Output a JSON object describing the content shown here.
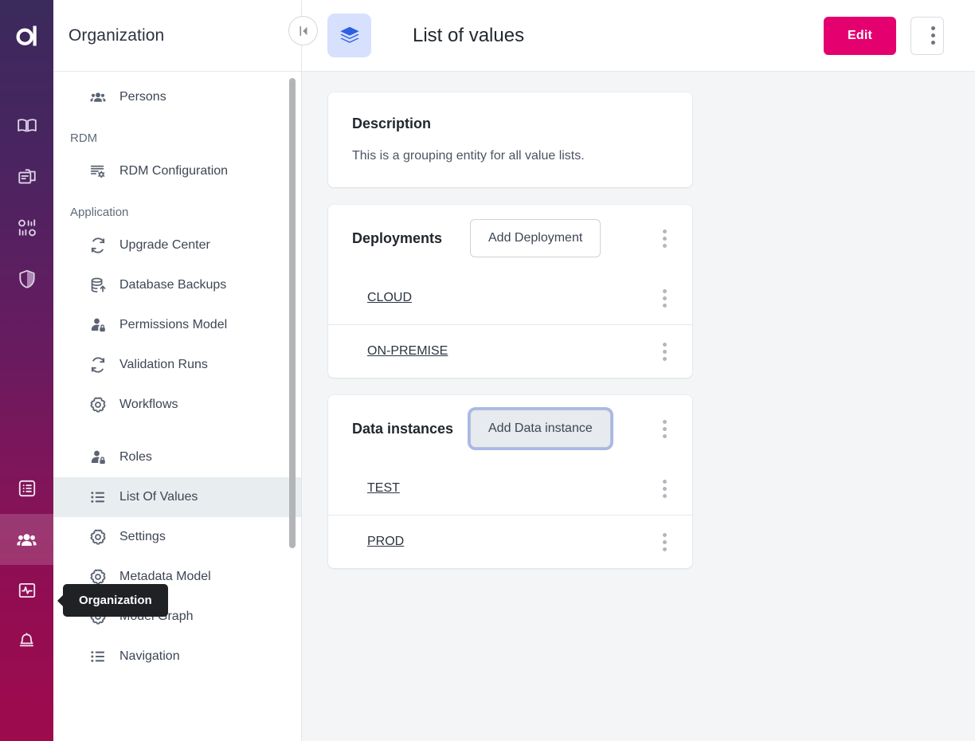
{
  "brand": {
    "logo_letter": "a",
    "rail_gradient_top": "#3B2A5C",
    "rail_gradient_bottom": "#9E0B4D",
    "accent_pink": "#E4006E",
    "entity_icon_bg": "#D7E0FD",
    "entity_icon_color": "#2F5FE0",
    "selected_nav_bg": "#E8EDF0"
  },
  "rail": {
    "logo_name": "logo-a-icon",
    "items": [
      {
        "name": "book-icon",
        "active": false
      },
      {
        "name": "folders-icon",
        "active": false
      },
      {
        "name": "data-model-icon",
        "active": false
      },
      {
        "name": "shield-icon",
        "active": false
      },
      {
        "name": "list-box-icon",
        "active": false
      },
      {
        "name": "people-icon",
        "active": true
      },
      {
        "name": "monitoring-icon",
        "active": false
      },
      {
        "name": "bell-icon",
        "active": false
      }
    ]
  },
  "sidebar": {
    "title": "Organization",
    "scrollbar": {
      "name": "sidebar-scrollbar"
    },
    "items": [
      {
        "type": "item",
        "label": "Persons",
        "icon": "people-icon",
        "selected": false
      },
      {
        "type": "group",
        "label": "RDM"
      },
      {
        "type": "item",
        "label": "RDM Configuration",
        "icon": "list-settings-icon",
        "selected": false
      },
      {
        "type": "group",
        "label": "Application"
      },
      {
        "type": "item",
        "label": "Upgrade Center",
        "icon": "refresh-icon",
        "selected": false
      },
      {
        "type": "item",
        "label": "Database Backups",
        "icon": "database-up-icon",
        "selected": false
      },
      {
        "type": "item",
        "label": "Permissions Model",
        "icon": "user-lock-icon",
        "selected": false
      },
      {
        "type": "item",
        "label": "Validation Runs",
        "icon": "refresh-icon",
        "selected": false
      },
      {
        "type": "item",
        "label": "Workflows",
        "icon": "gear-icon",
        "selected": false
      },
      {
        "type": "blank"
      },
      {
        "type": "item",
        "label": "Roles",
        "icon": "user-lock-icon",
        "selected": false
      },
      {
        "type": "item",
        "label": "List Of Values",
        "icon": "bullet-list-icon",
        "selected": true
      },
      {
        "type": "item",
        "label": "Settings",
        "icon": "gear-icon",
        "selected": false
      },
      {
        "type": "item",
        "label": "Metadata Model",
        "icon": "gear-icon",
        "selected": false
      },
      {
        "type": "item",
        "label": "Model Graph",
        "icon": "gear-icon",
        "selected": false
      },
      {
        "type": "item",
        "label": "Navigation",
        "icon": "bullet-list-icon",
        "selected": false
      }
    ]
  },
  "tooltip": {
    "text": "Organization"
  },
  "collapse_button": {
    "name": "collapse-sidebar-button",
    "icon": "skip-back-icon"
  },
  "header": {
    "entity_icon": "layers-icon",
    "title": "List of values",
    "edit_label": "Edit",
    "kebab_name": "header-more-options-button"
  },
  "cards": {
    "description": {
      "title": "Description",
      "text": "This is a grouping entity for all value lists."
    },
    "deployments": {
      "title": "Deployments",
      "add_label": "Add Deployment",
      "add_focused": false,
      "rows": [
        {
          "label": "CLOUD"
        },
        {
          "label": "ON-PREMISE"
        }
      ]
    },
    "data_instances": {
      "title": "Data instances",
      "add_label": "Add Data instance",
      "add_focused": true,
      "rows": [
        {
          "label": "TEST"
        },
        {
          "label": "PROD"
        }
      ]
    }
  }
}
